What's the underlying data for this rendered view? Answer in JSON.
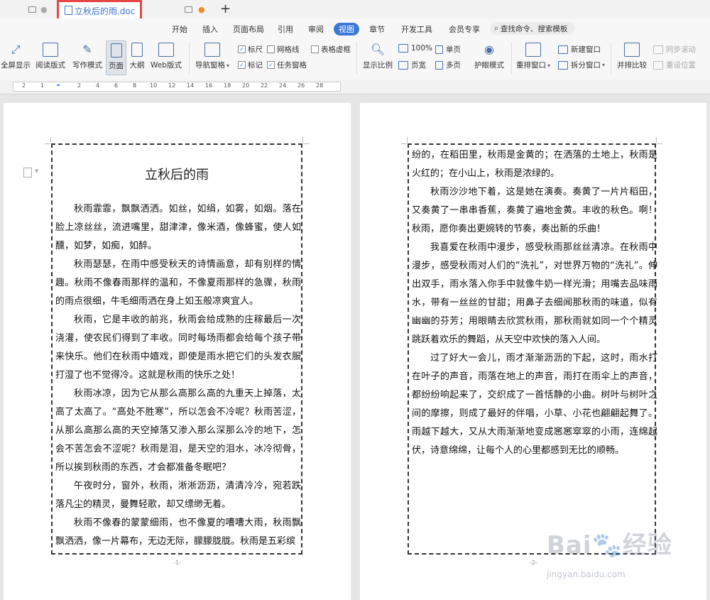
{
  "tabs": {
    "active_title": "立秋后的雨.doc",
    "add": "+"
  },
  "menu": [
    "开始",
    "插入",
    "页面布局",
    "引用",
    "审阅",
    "视图",
    "章节",
    "开发工具",
    "会员专享"
  ],
  "menu_active": "视图",
  "search": "查找命令、搜索模板",
  "ribbon": {
    "fullscreen": "全屏显示",
    "reading": "阅读版式",
    "writing": "写作模式",
    "page": "页面",
    "outline": "大纲",
    "web": "Web版式",
    "nav_pane": "导航窗格",
    "ruler": "标尺",
    "gridlines": "网格线",
    "table_gridlines": "表格虚框",
    "marks": "标记",
    "task_pane": "任务窗格",
    "zoom": "显示比例",
    "zoom_100": "100%",
    "page_width": "页宽",
    "single_page": "单页",
    "multi_page": "多页",
    "eye_mode": "护眼模式",
    "rearrange": "重排窗口",
    "new_window": "新建窗口",
    "split_window": "拆分窗口",
    "compare": "并排比较",
    "sync_scroll": "同步滚动",
    "reset_position": "重设位置"
  },
  "doc": {
    "title": "立秋后的雨",
    "page1_paragraphs": [
      "秋雨霏霏，飘飘洒洒。如丝，如绢，如雾，如烟。落在脸上凉丝丝，流进嘴里，甜津津，像米酒，像蜂蜜，使人如醺，如梦，如痴，如醉。",
      "秋雨瑟瑟，在雨中感受秋天的诗情画意，却有别样的情趣。秋雨不像春雨那样的温和，不像夏雨那样的急骤，秋雨的雨点很细，牛毛细雨洒在身上如玉般凉爽宜人。",
      "秋雨，它是丰收的前兆，秋雨会给成熟的庄稼最后一次浇灌，使农民们得到了丰收。同时每场雨都会给每个孩子带来快乐。他们在秋雨中嬉戏，即使是雨水把它们的头发衣服打湿了也不觉得冷。这就是秋雨的快乐之处！",
      "秋雨冰凉，因为它从那么高那么高的九重天上掉落，太高了太高了。“高处不胜寒”，所以怎会不冷呢？秋雨苦涩，从那么高那么高的天空掉落又渗入那么深那么冷的地下，怎会不苦怎会不涩呢？秋雨是泪，是天空的泪水，冰冷彻骨，所以挨到秋雨的东西，才会都准备冬眠吧？",
      "午夜时分，窗外，秋雨，淅淅沥沥，清清冷冷，宛若跌落凡尘的精灵，曼舞轻歌，却又缥缈无着。",
      "秋雨不像春的蒙蒙细雨，也不像夏的嘈嘈大雨，秋雨飘飘洒洒，像一片幕布，无边无际，朦朦胧胧。秋雨是五彩缤"
    ],
    "page2_continuation": "纷的，在稻田里，秋雨是金黄的；在洒落的土地上，秋雨是火红的；在小山上，秋雨是浓绿的。",
    "page2_paragraphs": [
      "秋雨沙沙地下着，这是她在演奏。奏黄了一片片稻田，又奏黄了一串串香蕉，奏黄了遍地金黄。丰收的秋色。啊！秋雨，愿你奏出更婉转的节奏，奏出新的乐曲！",
      "我喜爱在秋雨中漫步，感受秋雨那丝丝清凉。在秋雨中漫步，感受秋雨对人们的“洗礼”，对世界万物的“洗礼”。伸出双手，雨水落入你手中就像牛奶一样光滑；用嘴去品味雨水，带有一丝丝的甘甜；用鼻子去细闻那秋雨的味道，似有幽幽的芬芳；用眼睛去欣赏秋雨，那秋雨就如同一个个精灵跳跃着欢乐的舞蹈，从天空中欢快的落入人间。",
      "过了好大一会儿，雨才渐渐沥沥的下起，这时，雨水打在叶子的声音，雨落在地上的声音，雨打在雨伞上的声音，都纷纷响起来了，交织成了一首恬静的小曲。树叶与树叶之间的摩擦，则成了最好的伴唱，小草、小花也翩翩起舞了。雨越下越大，又从大雨渐渐地变成窸窸窣窣的小雨，连绵起伏，诗意绵绵，让每个人的心里都感到无比的顺畅。"
    ],
    "page1_num": "-1-",
    "page2_num": "-2-"
  },
  "watermark": {
    "brand": "Bai🐾经验",
    "url": "jingyan.baidu.com"
  },
  "colors": {
    "accent": "#3c78d8",
    "highlight_border": "#e64545"
  }
}
